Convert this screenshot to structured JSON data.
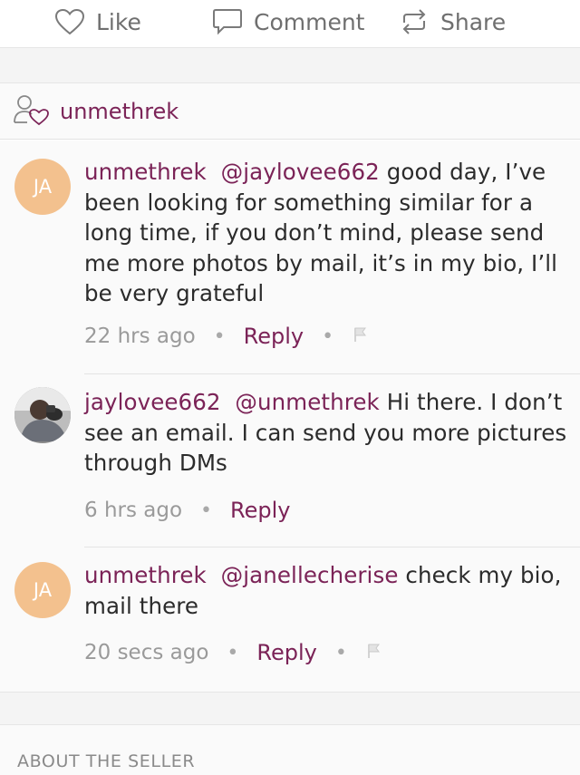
{
  "actions": {
    "like": "Like",
    "comment": "Comment",
    "share": "Share"
  },
  "likers": {
    "name": "unmethrek"
  },
  "comments": [
    {
      "initials": "JA",
      "user": "unmethrek",
      "mention": "@jaylovee662",
      "text": "good day, I’ve been looking for something similar for a long time, if you don’t mind, please send me more photos by mail, it’s in my bio, I’ll be very grateful",
      "time": "22 hrs ago",
      "reply": "Reply"
    },
    {
      "initials": "",
      "user": "jaylovee662",
      "mention": "@unmethrek",
      "text": "Hi there. I don’t see an email. I can send you more pictures through DMs",
      "time": "6 hrs ago",
      "reply": "Reply"
    },
    {
      "initials": "JA",
      "user": "unmethrek",
      "mention": "@janellecherise",
      "text": "check my bio, mail there",
      "time": "20 secs ago",
      "reply": "Reply"
    }
  ],
  "about": {
    "title": "ABOUT THE SELLER"
  },
  "colors": {
    "accent": "#7b2357",
    "avatar_bg": "#f3c18e",
    "muted": "#9a9a9a"
  }
}
